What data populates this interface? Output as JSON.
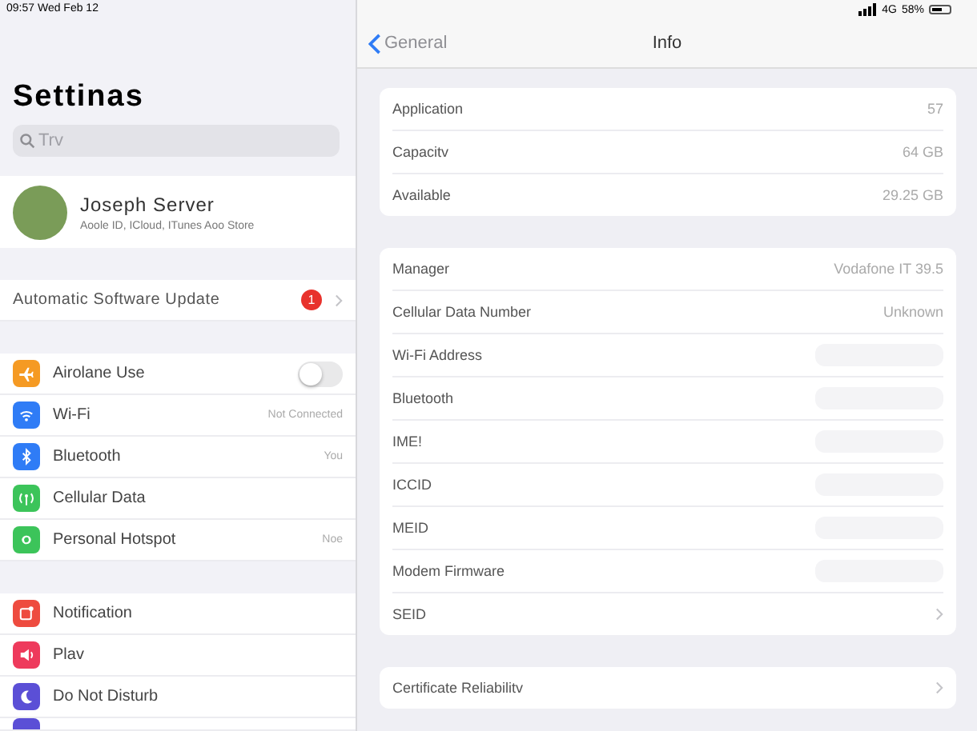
{
  "status_bar": {
    "time": "09:57 Wed Feb 12",
    "network": "4G",
    "battery": "58%"
  },
  "sidebar": {
    "title": "Settinas",
    "search": {
      "placeholder": "Trv"
    },
    "profile": {
      "name": "Joseph Server",
      "subtitle": "Aoole ID, ICloud, ITunes Aoo Store"
    },
    "update": {
      "label": "Automatic Software Update",
      "badge": "1"
    },
    "groups": [
      [
        {
          "label": "Airolane Use",
          "kind": "toggle",
          "on": false,
          "color": "#f59a23"
        },
        {
          "label": "Wi-Fi",
          "kind": "value",
          "value": "Not Connected",
          "color": "#2f7cf6"
        },
        {
          "label": "Bluetooth",
          "kind": "value",
          "value": "You",
          "color": "#2f7cf6"
        },
        {
          "label": "Cellular Data",
          "kind": "plain",
          "color": "#3cc45a"
        },
        {
          "label": "Personal Hotspot",
          "kind": "value",
          "value": "Noe",
          "color": "#3cc45a"
        }
      ],
      [
        {
          "label": "Notification",
          "kind": "plain",
          "color": "#ee4b3f"
        },
        {
          "label": "Plav",
          "kind": "plain",
          "color": "#ee3a5c"
        },
        {
          "label": "Do Not Disturb",
          "kind": "plain",
          "color": "#5b4fd6"
        },
        {
          "kind": "partial",
          "color": "#5b4fd6"
        }
      ]
    ]
  },
  "detail": {
    "back": "General",
    "title": "Info",
    "groups": [
      [
        {
          "label": "Application",
          "value": "57",
          "kind": "value"
        },
        {
          "label": "Capacitv",
          "value": "64 GB",
          "kind": "value"
        },
        {
          "label": "Available",
          "value": "29.25 GB",
          "kind": "value"
        }
      ],
      [
        {
          "label": "Manager",
          "value": "Vodafone IT 39.5",
          "kind": "value"
        },
        {
          "label": "Cellular Data Number",
          "value": "Unknown",
          "kind": "value"
        },
        {
          "label": "Wi-Fi Address",
          "kind": "hidden"
        },
        {
          "label": "Bluetooth",
          "kind": "hidden"
        },
        {
          "label": "IME!",
          "kind": "hidden"
        },
        {
          "label": "ICCID",
          "kind": "hidden"
        },
        {
          "label": "MEID",
          "kind": "hidden"
        },
        {
          "label": "Modem Firmware",
          "kind": "hidden"
        },
        {
          "label": "SEID",
          "kind": "link"
        }
      ],
      [
        {
          "label": "Certificate Reliabilitv",
          "kind": "link"
        }
      ]
    ]
  }
}
